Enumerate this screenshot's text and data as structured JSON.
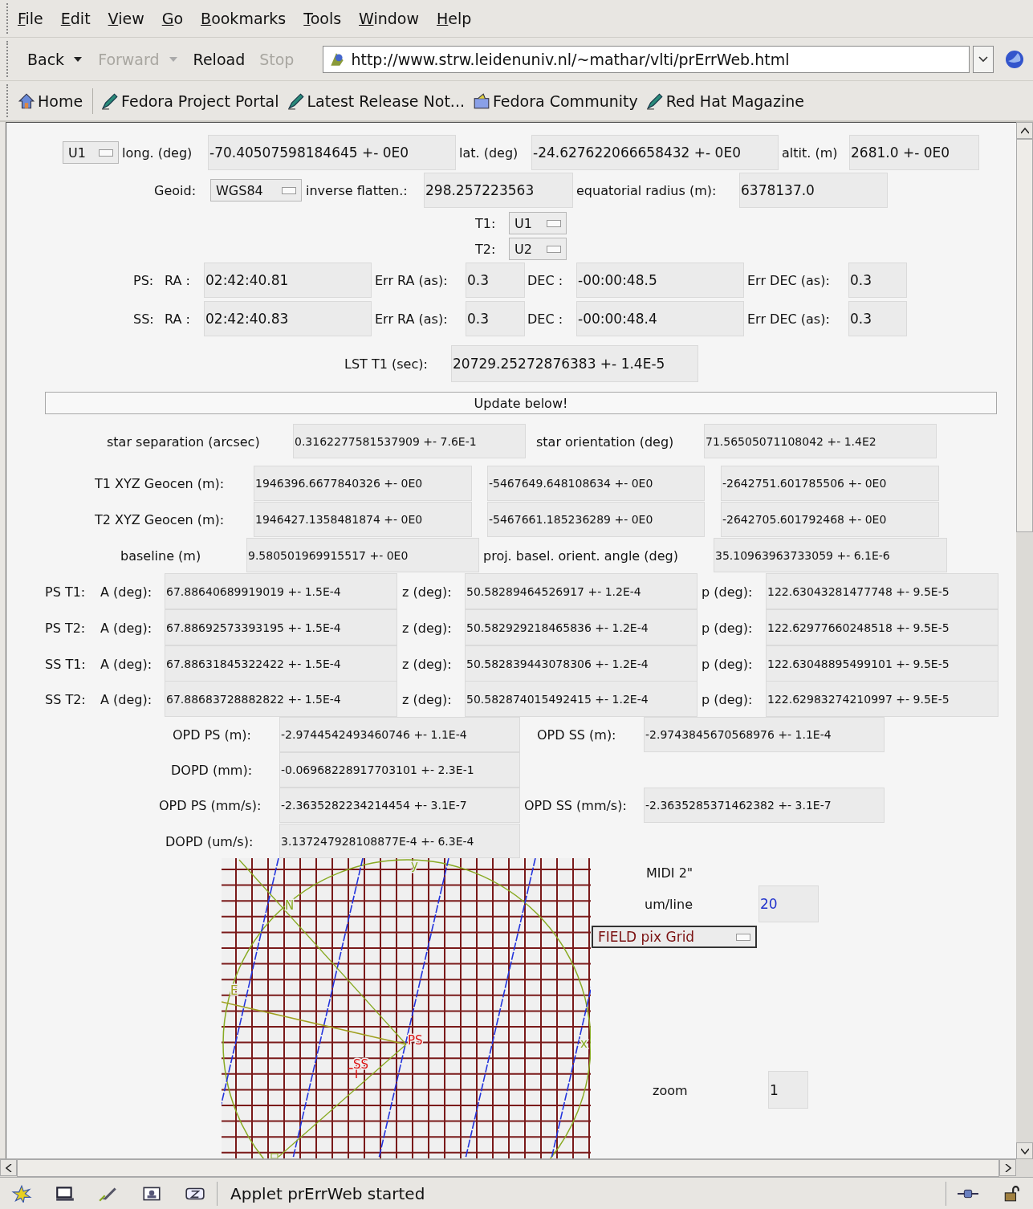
{
  "menu": [
    {
      "label": "File"
    },
    {
      "label": "Edit"
    },
    {
      "label": "View"
    },
    {
      "label": "Go"
    },
    {
      "label": "Bookmarks"
    },
    {
      "label": "Tools"
    },
    {
      "label": "Window"
    },
    {
      "label": "Help"
    }
  ],
  "navigation": [
    {
      "label": "Back",
      "disabled": false,
      "dropdown": true
    },
    {
      "label": "Forward",
      "disabled": true,
      "dropdown": true
    },
    {
      "label": "Reload",
      "disabled": false,
      "dropdown": false
    },
    {
      "label": "Stop",
      "disabled": true,
      "dropdown": false
    }
  ],
  "address": {
    "value": "http://www.strw.leidenuniv.nl/~mathar/vlti/prErrWeb.html"
  },
  "bookmarks": [
    {
      "label": "Home",
      "kind": "home"
    },
    {
      "label": "Fedora Project Portal",
      "kind": "page"
    },
    {
      "label": "Latest Release Not...",
      "kind": "page"
    },
    {
      "label": "Fedora Community",
      "kind": "folder"
    },
    {
      "label": "Red Hat Magazine",
      "kind": "page"
    }
  ],
  "applet": {
    "rows": [
      {
        "cells": [
          {
            "kind": "choice",
            "value": "U1"
          },
          {
            "kind": "label",
            "text": "long. (deg)"
          },
          {
            "kind": "field",
            "value": "-70.40507598184645 +- 0E0"
          },
          {
            "kind": "label",
            "text": "lat. (deg)"
          },
          {
            "kind": "field",
            "value": "-24.627622066658432 +- 0E0"
          },
          {
            "kind": "label",
            "text": "altit. (m)"
          },
          {
            "kind": "field",
            "value": "2681.0 +- 0E0"
          }
        ]
      },
      {
        "cells": [
          {
            "kind": "label",
            "text": "Geoid:"
          },
          {
            "kind": "choice",
            "value": "WGS84"
          },
          {
            "kind": "label",
            "text": "inverse flatten.:"
          },
          {
            "kind": "field",
            "value": "298.257223563"
          },
          {
            "kind": "label",
            "text": "equatorial radius (m):"
          },
          {
            "kind": "field",
            "value": "6378137.0"
          }
        ]
      },
      {
        "cells": [
          {
            "kind": "label",
            "text": "T1:"
          },
          {
            "kind": "choice",
            "value": "U1"
          }
        ]
      },
      {
        "cells": [
          {
            "kind": "label",
            "text": "T2:"
          },
          {
            "kind": "choice",
            "value": "U2"
          }
        ]
      },
      {
        "cells": [
          {
            "kind": "label",
            "text": "PS:"
          },
          {
            "kind": "label",
            "text": "RA :"
          },
          {
            "kind": "field",
            "value": "02:42:40.81"
          },
          {
            "kind": "label",
            "text": "Err RA (as):"
          },
          {
            "kind": "field",
            "value": "0.3"
          },
          {
            "kind": "label",
            "text": "DEC :"
          },
          {
            "kind": "field",
            "value": "-00:00:48.5"
          },
          {
            "kind": "label",
            "text": "Err DEC (as):"
          },
          {
            "kind": "field",
            "value": "0.3"
          }
        ]
      },
      {
        "cells": [
          {
            "kind": "label",
            "text": "SS:"
          },
          {
            "kind": "label",
            "text": "RA :"
          },
          {
            "kind": "field",
            "value": "02:42:40.83"
          },
          {
            "kind": "label",
            "text": "Err RA (as):"
          },
          {
            "kind": "field",
            "value": "0.3"
          },
          {
            "kind": "label",
            "text": "DEC :"
          },
          {
            "kind": "field",
            "value": "-00:00:48.4"
          },
          {
            "kind": "label",
            "text": "Err DEC (as):"
          },
          {
            "kind": "field",
            "value": "0.3"
          }
        ]
      },
      {
        "cells": [
          {
            "kind": "label",
            "text": "LST T1 (sec):"
          },
          {
            "kind": "field",
            "value": "20729.25272876383 +- 1.4E-5"
          }
        ]
      },
      {
        "cells": [
          {
            "kind": "button",
            "label": "Update below!"
          }
        ]
      },
      {
        "cells": [
          {
            "kind": "label",
            "text": "star separation (arcsec)"
          },
          {
            "kind": "field",
            "value": "0.3162277581537909 +- 7.6E-1"
          },
          {
            "kind": "label",
            "text": "star orientation (deg)"
          },
          {
            "kind": "field",
            "value": "71.56505071108042 +- 1.4E2"
          }
        ]
      },
      {
        "cells": [
          {
            "kind": "label",
            "text": "T1 XYZ Geocen (m):"
          },
          {
            "kind": "field",
            "value": "1946396.6677840326 +- 0E0"
          },
          {
            "kind": "field",
            "value": "-5467649.648108634 +- 0E0"
          },
          {
            "kind": "field",
            "value": "-2642751.601785506 +- 0E0"
          }
        ]
      },
      {
        "cells": [
          {
            "kind": "label",
            "text": "T2 XYZ Geocen (m):"
          },
          {
            "kind": "field",
            "value": "1946427.1358481874 +- 0E0"
          },
          {
            "kind": "field",
            "value": "-5467661.185236289 +- 0E0"
          },
          {
            "kind": "field",
            "value": "-2642705.601792468 +- 0E0"
          }
        ]
      },
      {
        "cells": [
          {
            "kind": "label",
            "text": "baseline (m)"
          },
          {
            "kind": "field",
            "value": "9.580501969915517 +- 0E0"
          },
          {
            "kind": "label",
            "text": "proj. basel. orient. angle (deg)"
          },
          {
            "kind": "field",
            "value": "35.10963963733059 +- 6.1E-6"
          }
        ]
      },
      {
        "cells": [
          {
            "kind": "label",
            "text": "PS T1:"
          },
          {
            "kind": "label",
            "text": "A (deg):"
          },
          {
            "kind": "field",
            "value": "67.88640689919019 +- 1.5E-4"
          },
          {
            "kind": "label",
            "text": "z (deg):"
          },
          {
            "kind": "field",
            "value": "50.58289464526917 +- 1.2E-4"
          },
          {
            "kind": "label",
            "text": "p (deg):"
          },
          {
            "kind": "field",
            "value": "122.63043281477748 +- 9.5E-5"
          }
        ]
      },
      {
        "cells": [
          {
            "kind": "label",
            "text": "PS T2:"
          },
          {
            "kind": "label",
            "text": "A (deg):"
          },
          {
            "kind": "field",
            "value": "67.88692573393195 +- 1.5E-4"
          },
          {
            "kind": "label",
            "text": "z (deg):"
          },
          {
            "kind": "field",
            "value": "50.582929218465836 +- 1.2E-4"
          },
          {
            "kind": "label",
            "text": "p (deg):"
          },
          {
            "kind": "field",
            "value": "122.62977660248518 +- 9.5E-5"
          }
        ]
      },
      {
        "cells": [
          {
            "kind": "label",
            "text": "SS T1:"
          },
          {
            "kind": "label",
            "text": "A (deg):"
          },
          {
            "kind": "field",
            "value": "67.88631845322422 +- 1.5E-4"
          },
          {
            "kind": "label",
            "text": "z (deg):"
          },
          {
            "kind": "field",
            "value": "50.582839443078306 +- 1.2E-4"
          },
          {
            "kind": "label",
            "text": "p (deg):"
          },
          {
            "kind": "field",
            "value": "122.63048895499101 +- 9.5E-5"
          }
        ]
      },
      {
        "cells": [
          {
            "kind": "label",
            "text": "SS T2:"
          },
          {
            "kind": "label",
            "text": "A (deg):"
          },
          {
            "kind": "field",
            "value": "67.88683728882822 +- 1.5E-4"
          },
          {
            "kind": "label",
            "text": "z (deg):"
          },
          {
            "kind": "field",
            "value": "50.582874015492415 +- 1.2E-4"
          },
          {
            "kind": "label",
            "text": "p (deg):"
          },
          {
            "kind": "field",
            "value": "122.62983274210997 +- 9.5E-5"
          }
        ]
      },
      {
        "cells": [
          {
            "kind": "label",
            "text": "OPD PS (m):"
          },
          {
            "kind": "field",
            "value": "-2.9744542493460746 +- 1.1E-4"
          },
          {
            "kind": "label",
            "text": "OPD SS (m):"
          },
          {
            "kind": "field",
            "value": "-2.9743845670568976 +- 1.1E-4"
          }
        ]
      },
      {
        "cells": [
          {
            "kind": "label",
            "text": "DOPD (mm):"
          },
          {
            "kind": "field",
            "value": "-0.06968228917703101 +- 2.3E-1"
          }
        ]
      },
      {
        "cells": [
          {
            "kind": "label",
            "text": "OPD PS (mm/s):"
          },
          {
            "kind": "field",
            "value": "-2.3635282234214454 +- 3.1E-7"
          },
          {
            "kind": "label",
            "text": "OPD SS (mm/s):"
          },
          {
            "kind": "field",
            "value": "-2.3635285371462382 +- 3.1E-7"
          }
        ]
      },
      {
        "cells": [
          {
            "kind": "label",
            "text": "DOPD (um/s):"
          },
          {
            "kind": "field",
            "value": "3.137247928108877E-4 +- 6.3E-4"
          }
        ]
      },
      {
        "cells": [
          {
            "kind": "label",
            "text": "MIDI 2\""
          }
        ]
      },
      {
        "cells": [
          {
            "kind": "label",
            "text": "um/line"
          },
          {
            "kind": "field",
            "value": "20",
            "color": "#2233cc"
          }
        ]
      },
      {
        "cells": [
          {
            "kind": "choice",
            "value": "FIELD pix Grid",
            "color": "#7a1010"
          }
        ]
      },
      {
        "cells": [
          {
            "kind": "label",
            "text": "zoom"
          },
          {
            "kind": "field",
            "value": "1"
          }
        ]
      }
    ],
    "plot": {
      "labels": [
        {
          "text": "y",
          "color": "#88aa22"
        },
        {
          "text": "N",
          "color": "#88aa22"
        },
        {
          "text": "E",
          "color": "#a0a020"
        },
        {
          "text": "PS",
          "color": "#dd1111"
        },
        {
          "text": "SS",
          "color": "#dd1111"
        },
        {
          "text": "x",
          "color": "#88aa22"
        }
      ]
    }
  },
  "status_bar": {
    "text": "Applet prErrWeb started"
  }
}
